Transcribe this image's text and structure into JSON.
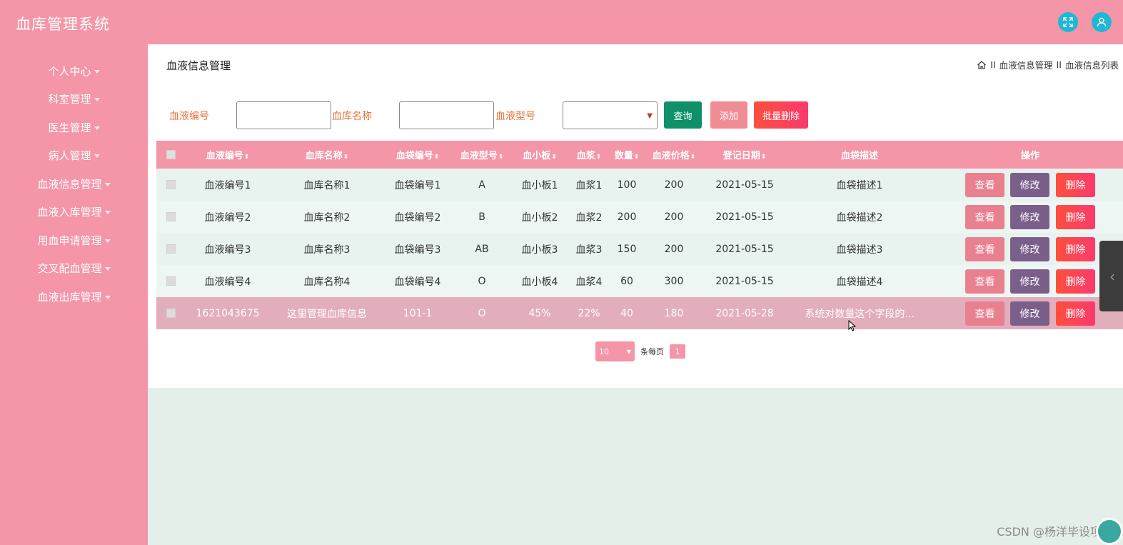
{
  "header": {
    "app_title": "血库管理系统",
    "icons": [
      "fullscreen-icon",
      "user-icon"
    ]
  },
  "sidebar": {
    "items": [
      {
        "label": "个人中心"
      },
      {
        "label": "科室管理"
      },
      {
        "label": "医生管理"
      },
      {
        "label": "病人管理"
      },
      {
        "label": "血液信息管理"
      },
      {
        "label": "血液入库管理"
      },
      {
        "label": "用血申请管理"
      },
      {
        "label": "交叉配血管理"
      },
      {
        "label": "血液出库管理"
      }
    ]
  },
  "page": {
    "title": "血液信息管理",
    "breadcrumb": [
      "血液信息管理",
      "血液信息列表"
    ],
    "breadcrumb_separator": "II"
  },
  "filters": {
    "blood_id_label": "血液编号",
    "bank_name_label": "血库名称",
    "blood_type_label": "血液型号",
    "blood_id_value": "",
    "bank_name_value": "",
    "blood_type_value": ""
  },
  "buttons": {
    "query": "查询",
    "add": "添加",
    "batch_delete": "批量删除"
  },
  "table": {
    "columns": [
      "血液编号",
      "血库名称",
      "血袋编号",
      "血液型号",
      "血小板",
      "血浆",
      "数量",
      "血液价格",
      "登记日期",
      "血袋描述",
      "操作"
    ],
    "rows": [
      [
        "血液编号1",
        "血库名称1",
        "血袋编号1",
        "A",
        "血小板1",
        "血浆1",
        "100",
        "200",
        "2021-05-15",
        "血袋描述1"
      ],
      [
        "血液编号2",
        "血库名称2",
        "血袋编号2",
        "B",
        "血小板2",
        "血浆2",
        "200",
        "200",
        "2021-05-15",
        "血袋描述2"
      ],
      [
        "血液编号3",
        "血库名称3",
        "血袋编号3",
        "AB",
        "血小板3",
        "血浆3",
        "150",
        "200",
        "2021-05-15",
        "血袋描述3"
      ],
      [
        "血液编号4",
        "血库名称4",
        "血袋编号4",
        "O",
        "血小板4",
        "血浆4",
        "60",
        "300",
        "2021-05-15",
        "血袋描述4"
      ],
      [
        "1621043675",
        "这里管理血库信息",
        "101-1",
        "O",
        "45%",
        "22%",
        "40",
        "180",
        "2021-05-28",
        "系统对数量这个字段的..."
      ]
    ],
    "actions": {
      "view": "查看",
      "edit": "修改",
      "delete": "删除"
    }
  },
  "pagination": {
    "page_size": "10",
    "per_page_text": "条每页",
    "current_page": "1"
  },
  "watermark": "CSDN @杨洋毕设项目",
  "colors": {
    "primary": "#f495a8",
    "query": "#109068",
    "edit": "#7a5f8a",
    "danger": "#fd4f3d"
  }
}
